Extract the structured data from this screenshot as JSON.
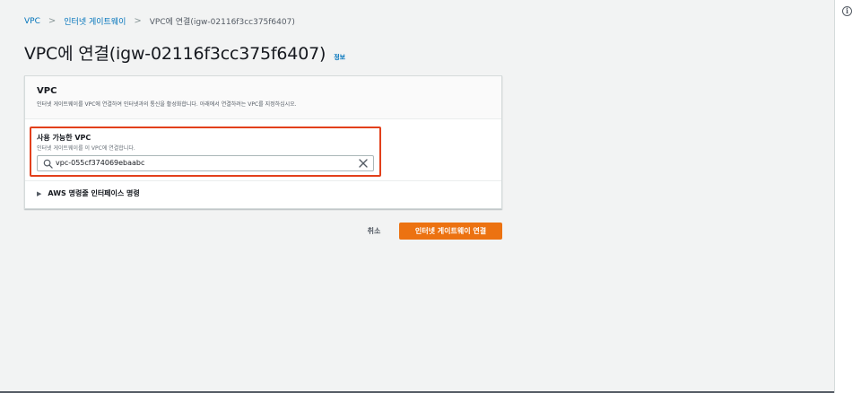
{
  "breadcrumb": {
    "items": [
      "VPC",
      "인터넷 게이트웨이"
    ],
    "separator": ">",
    "current": "VPC에 연결(igw-02116f3cc375f6407)"
  },
  "header": {
    "title": "VPC에 연결(igw-02116f3cc375f6407)",
    "info_link": "정보"
  },
  "panel": {
    "title": "VPC",
    "description": "인터넷 게이트웨이를 VPC에 연결하여 인터넷과의 통신을 활성화합니다. 아래에서 연결하려는 VPC를 지정하십시오.",
    "field": {
      "label": "사용 가능한 VPC",
      "hint": "인터넷 게이트웨이를 이 VPC에 연결합니다.",
      "value": "vpc-055cf374069ebaabc",
      "search_icon": "search-icon",
      "clear_icon": "close-icon"
    },
    "expander": {
      "caret": "▶",
      "label": "AWS 명령줄 인터페이스 명령"
    }
  },
  "actions": {
    "cancel_label": "취소",
    "submit_label": "인터넷 게이트웨이 연결"
  },
  "rail": {
    "info_icon": "i"
  },
  "colors": {
    "accent": "#ec7211",
    "link": "#0073bb",
    "highlight": "#e2401b",
    "background": "#f2f3f3"
  }
}
